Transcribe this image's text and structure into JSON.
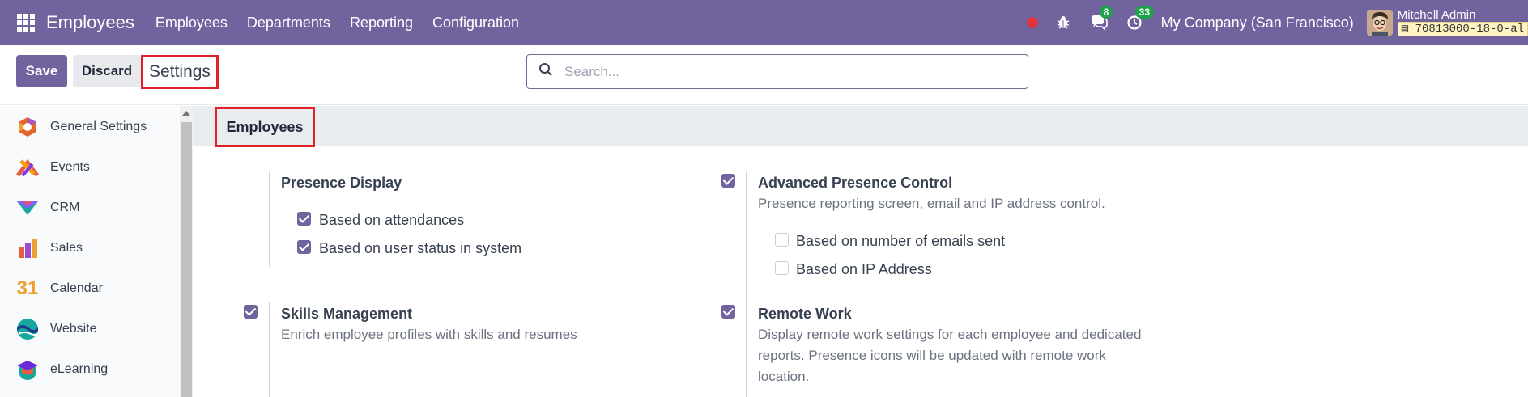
{
  "navbar": {
    "app_name": "Employees",
    "menu": [
      "Employees",
      "Departments",
      "Reporting",
      "Configuration"
    ],
    "messages_count": "8",
    "activities_count": "33",
    "company": "My Company (San Francisco)",
    "user_name": "Mitchell Admin",
    "db_name": "70813000-18-0-al"
  },
  "controls": {
    "save_label": "Save",
    "discard_label": "Discard",
    "breadcrumb": "Settings",
    "search_placeholder": "Search..."
  },
  "sidebar": {
    "items": [
      {
        "label": "General Settings",
        "icon": "general-settings-icon"
      },
      {
        "label": "Events",
        "icon": "events-icon"
      },
      {
        "label": "CRM",
        "icon": "crm-icon"
      },
      {
        "label": "Sales",
        "icon": "sales-icon"
      },
      {
        "label": "Calendar",
        "icon": "calendar-icon",
        "icon_text": "31"
      },
      {
        "label": "Website",
        "icon": "website-icon"
      },
      {
        "label": "eLearning",
        "icon": "elearning-icon"
      }
    ]
  },
  "section": {
    "title": "Employees",
    "presence_display": {
      "title": "Presence Display",
      "options": [
        {
          "label": "Based on attendances",
          "checked": true
        },
        {
          "label": "Based on user status in system",
          "checked": true
        }
      ]
    },
    "advanced_presence": {
      "title": "Advanced Presence Control",
      "checked": true,
      "description": "Presence reporting screen, email and IP address control.",
      "options": [
        {
          "label": "Based on number of emails sent",
          "checked": false
        },
        {
          "label": "Based on IP Address",
          "checked": false
        }
      ]
    },
    "skills": {
      "title": "Skills Management",
      "checked": true,
      "description": "Enrich employee profiles with skills and resumes"
    },
    "remote_work": {
      "title": "Remote Work",
      "checked": true,
      "description_lines": [
        "Display remote work settings for each employee and dedicated",
        "reports. Presence icons will be updated with remote work",
        "location."
      ]
    }
  },
  "colors": {
    "brand": "#71639e",
    "badge": "#1ea34b",
    "highlight": "#e0202a"
  }
}
